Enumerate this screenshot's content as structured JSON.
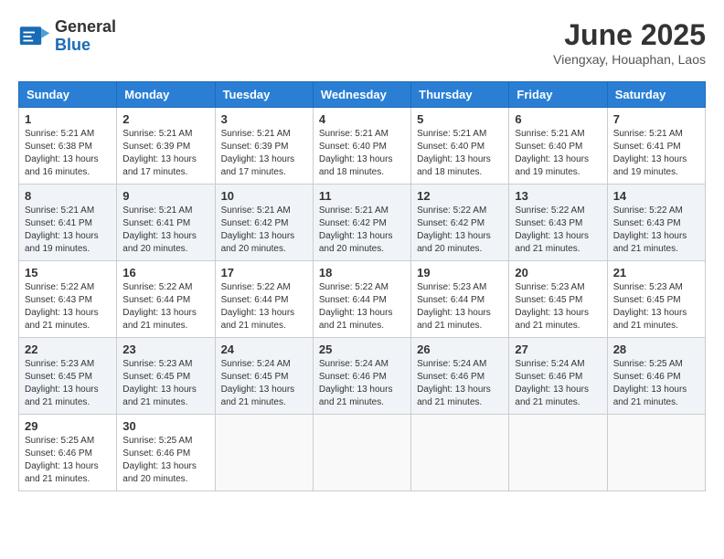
{
  "header": {
    "logo_general": "General",
    "logo_blue": "Blue",
    "month_title": "June 2025",
    "location": "Viengxay, Houaphan, Laos"
  },
  "days_of_week": [
    "Sunday",
    "Monday",
    "Tuesday",
    "Wednesday",
    "Thursday",
    "Friday",
    "Saturday"
  ],
  "weeks": [
    [
      {
        "day": "1",
        "sunrise": "5:21 AM",
        "sunset": "6:38 PM",
        "daylight": "13 hours and 16 minutes."
      },
      {
        "day": "2",
        "sunrise": "5:21 AM",
        "sunset": "6:39 PM",
        "daylight": "13 hours and 17 minutes."
      },
      {
        "day": "3",
        "sunrise": "5:21 AM",
        "sunset": "6:39 PM",
        "daylight": "13 hours and 17 minutes."
      },
      {
        "day": "4",
        "sunrise": "5:21 AM",
        "sunset": "6:40 PM",
        "daylight": "13 hours and 18 minutes."
      },
      {
        "day": "5",
        "sunrise": "5:21 AM",
        "sunset": "6:40 PM",
        "daylight": "13 hours and 18 minutes."
      },
      {
        "day": "6",
        "sunrise": "5:21 AM",
        "sunset": "6:40 PM",
        "daylight": "13 hours and 19 minutes."
      },
      {
        "day": "7",
        "sunrise": "5:21 AM",
        "sunset": "6:41 PM",
        "daylight": "13 hours and 19 minutes."
      }
    ],
    [
      {
        "day": "8",
        "sunrise": "5:21 AM",
        "sunset": "6:41 PM",
        "daylight": "13 hours and 19 minutes."
      },
      {
        "day": "9",
        "sunrise": "5:21 AM",
        "sunset": "6:41 PM",
        "daylight": "13 hours and 20 minutes."
      },
      {
        "day": "10",
        "sunrise": "5:21 AM",
        "sunset": "6:42 PM",
        "daylight": "13 hours and 20 minutes."
      },
      {
        "day": "11",
        "sunrise": "5:21 AM",
        "sunset": "6:42 PM",
        "daylight": "13 hours and 20 minutes."
      },
      {
        "day": "12",
        "sunrise": "5:22 AM",
        "sunset": "6:42 PM",
        "daylight": "13 hours and 20 minutes."
      },
      {
        "day": "13",
        "sunrise": "5:22 AM",
        "sunset": "6:43 PM",
        "daylight": "13 hours and 21 minutes."
      },
      {
        "day": "14",
        "sunrise": "5:22 AM",
        "sunset": "6:43 PM",
        "daylight": "13 hours and 21 minutes."
      }
    ],
    [
      {
        "day": "15",
        "sunrise": "5:22 AM",
        "sunset": "6:43 PM",
        "daylight": "13 hours and 21 minutes."
      },
      {
        "day": "16",
        "sunrise": "5:22 AM",
        "sunset": "6:44 PM",
        "daylight": "13 hours and 21 minutes."
      },
      {
        "day": "17",
        "sunrise": "5:22 AM",
        "sunset": "6:44 PM",
        "daylight": "13 hours and 21 minutes."
      },
      {
        "day": "18",
        "sunrise": "5:22 AM",
        "sunset": "6:44 PM",
        "daylight": "13 hours and 21 minutes."
      },
      {
        "day": "19",
        "sunrise": "5:23 AM",
        "sunset": "6:44 PM",
        "daylight": "13 hours and 21 minutes."
      },
      {
        "day": "20",
        "sunrise": "5:23 AM",
        "sunset": "6:45 PM",
        "daylight": "13 hours and 21 minutes."
      },
      {
        "day": "21",
        "sunrise": "5:23 AM",
        "sunset": "6:45 PM",
        "daylight": "13 hours and 21 minutes."
      }
    ],
    [
      {
        "day": "22",
        "sunrise": "5:23 AM",
        "sunset": "6:45 PM",
        "daylight": "13 hours and 21 minutes."
      },
      {
        "day": "23",
        "sunrise": "5:23 AM",
        "sunset": "6:45 PM",
        "daylight": "13 hours and 21 minutes."
      },
      {
        "day": "24",
        "sunrise": "5:24 AM",
        "sunset": "6:45 PM",
        "daylight": "13 hours and 21 minutes."
      },
      {
        "day": "25",
        "sunrise": "5:24 AM",
        "sunset": "6:46 PM",
        "daylight": "13 hours and 21 minutes."
      },
      {
        "day": "26",
        "sunrise": "5:24 AM",
        "sunset": "6:46 PM",
        "daylight": "13 hours and 21 minutes."
      },
      {
        "day": "27",
        "sunrise": "5:24 AM",
        "sunset": "6:46 PM",
        "daylight": "13 hours and 21 minutes."
      },
      {
        "day": "28",
        "sunrise": "5:25 AM",
        "sunset": "6:46 PM",
        "daylight": "13 hours and 21 minutes."
      }
    ],
    [
      {
        "day": "29",
        "sunrise": "5:25 AM",
        "sunset": "6:46 PM",
        "daylight": "13 hours and 21 minutes."
      },
      {
        "day": "30",
        "sunrise": "5:25 AM",
        "sunset": "6:46 PM",
        "daylight": "13 hours and 20 minutes."
      },
      {
        "day": "",
        "sunrise": "",
        "sunset": "",
        "daylight": ""
      },
      {
        "day": "",
        "sunrise": "",
        "sunset": "",
        "daylight": ""
      },
      {
        "day": "",
        "sunrise": "",
        "sunset": "",
        "daylight": ""
      },
      {
        "day": "",
        "sunrise": "",
        "sunset": "",
        "daylight": ""
      },
      {
        "day": "",
        "sunrise": "",
        "sunset": "",
        "daylight": ""
      }
    ]
  ]
}
